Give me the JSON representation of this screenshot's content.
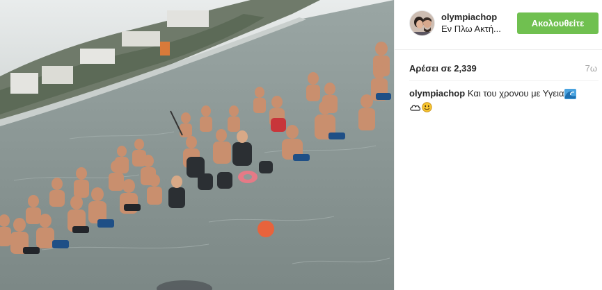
{
  "post": {
    "photo": {
      "description_icon": "photo"
    },
    "header": {
      "username": "olympiachop",
      "location": "Εν Πλω Ακτή...",
      "follow_label": "Ακολουθείτε"
    },
    "likes": {
      "text": "Αρέσει σε 2,339",
      "time_ago": "7ω"
    },
    "caption": {
      "username": "olympiachop",
      "text": "Και του χρονου με Υγεια",
      "emojis": [
        "wave-emoji",
        "cloud-emoji",
        "smiley-emoji"
      ]
    }
  },
  "colors": {
    "follow_button": "#70c050",
    "text": "#262626",
    "muted": "#a5a5a5",
    "border": "#efefef"
  }
}
